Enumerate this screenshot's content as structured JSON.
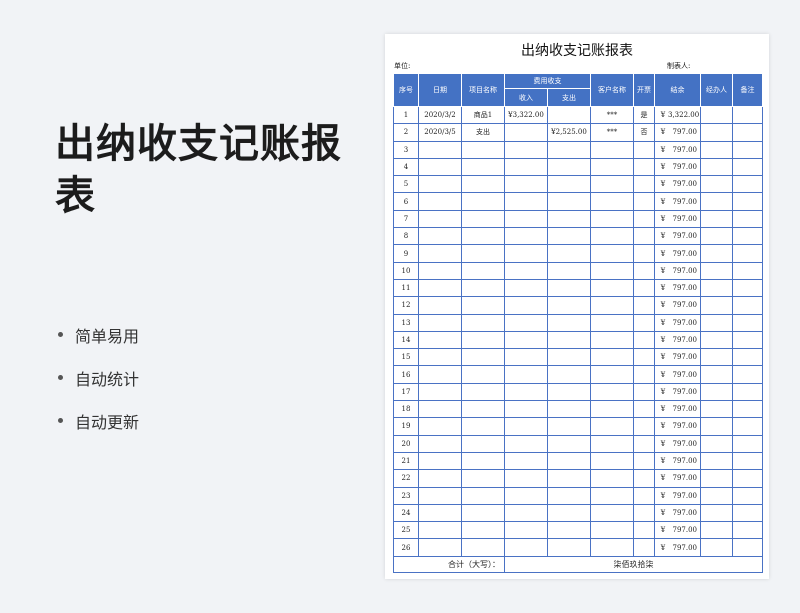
{
  "hero": {
    "title": "出纳收支记账报表"
  },
  "features": [
    "简单易用",
    "自动统计",
    "自动更新"
  ],
  "sheet": {
    "title": "出纳收支记账报表",
    "unit_label": "单位:",
    "maker_label": "制表人:",
    "headers": {
      "no": "序号",
      "date": "日期",
      "item": "项目名称",
      "fee_group": "费用收支",
      "income": "收入",
      "expense": "支出",
      "customer": "客户名称",
      "invoice": "开票",
      "balance": "结余",
      "handler": "经办人",
      "remark": "备注"
    },
    "rows": [
      {
        "no": "1",
        "date": "2020/3/2",
        "item": "商品1",
        "income": "¥3,322.00",
        "expense": "",
        "customer": "***",
        "invoice": "是",
        "yen": "¥",
        "balance": "3,322.00"
      },
      {
        "no": "2",
        "date": "2020/3/5",
        "item": "支出",
        "income": "",
        "expense": "¥2,525.00",
        "customer": "***",
        "invoice": "否",
        "yen": "¥",
        "balance": "797.00"
      },
      {
        "no": "3",
        "yen": "¥",
        "balance": "797.00"
      },
      {
        "no": "4",
        "yen": "¥",
        "balance": "797.00"
      },
      {
        "no": "5",
        "yen": "¥",
        "balance": "797.00"
      },
      {
        "no": "6",
        "yen": "¥",
        "balance": "797.00"
      },
      {
        "no": "7",
        "yen": "¥",
        "balance": "797.00"
      },
      {
        "no": "8",
        "yen": "¥",
        "balance": "797.00"
      },
      {
        "no": "9",
        "yen": "¥",
        "balance": "797.00"
      },
      {
        "no": "10",
        "yen": "¥",
        "balance": "797.00"
      },
      {
        "no": "11",
        "yen": "¥",
        "balance": "797.00"
      },
      {
        "no": "12",
        "yen": "¥",
        "balance": "797.00"
      },
      {
        "no": "13",
        "yen": "¥",
        "balance": "797.00"
      },
      {
        "no": "14",
        "yen": "¥",
        "balance": "797.00"
      },
      {
        "no": "15",
        "yen": "¥",
        "balance": "797.00"
      },
      {
        "no": "16",
        "yen": "¥",
        "balance": "797.00"
      },
      {
        "no": "17",
        "yen": "¥",
        "balance": "797.00"
      },
      {
        "no": "18",
        "yen": "¥",
        "balance": "797.00"
      },
      {
        "no": "19",
        "yen": "¥",
        "balance": "797.00"
      },
      {
        "no": "20",
        "yen": "¥",
        "balance": "797.00"
      },
      {
        "no": "21",
        "yen": "¥",
        "balance": "797.00"
      },
      {
        "no": "22",
        "yen": "¥",
        "balance": "797.00"
      },
      {
        "no": "23",
        "yen": "¥",
        "balance": "797.00"
      },
      {
        "no": "24",
        "yen": "¥",
        "balance": "797.00"
      },
      {
        "no": "25",
        "yen": "¥",
        "balance": "797.00"
      },
      {
        "no": "26",
        "yen": "¥",
        "balance": "797.00"
      }
    ],
    "total_label": "合计（大写）：",
    "total_value": "柒佰玖拾柒"
  }
}
